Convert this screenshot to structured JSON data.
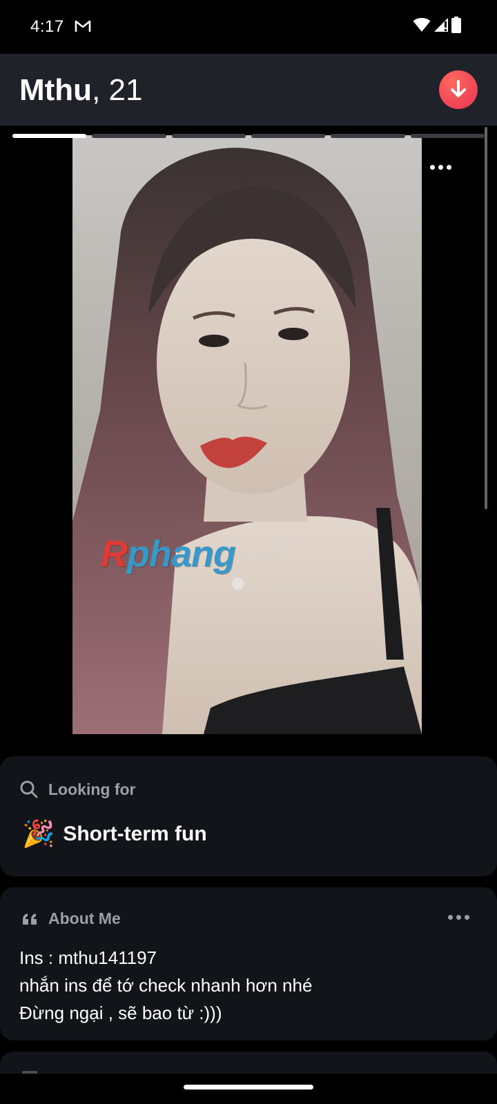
{
  "status_bar": {
    "time": "4:17",
    "icons": [
      "gmail-icon",
      "wifi-icon",
      "signal-icon",
      "battery-icon"
    ]
  },
  "header": {
    "name": "Mthu",
    "separator": ",",
    "age": "21",
    "action_icon": "arrow-down-icon",
    "action_color": "#ef4258"
  },
  "photo": {
    "photo_count": 6,
    "current_photo": 1,
    "watermark": {
      "first_letter": "R",
      "rest": "phang"
    },
    "more_icon": "ellipsis-icon",
    "description_icon": "profile-photo"
  },
  "looking_for": {
    "icon": "search-icon",
    "label": "Looking for",
    "emoji": "🎉",
    "value": "Short-term fun"
  },
  "about_me": {
    "icon": "quote-icon",
    "label": "About Me",
    "lines": [
      "Ins : mthu141197",
      "nhắn ins để tớ check nhanh hơn nhé",
      "Đừng ngại , sẽ bao từ :)))"
    ]
  },
  "colors": {
    "background": "#000000",
    "header_bg": "#1f2228",
    "card_bg": "#111418",
    "muted_text": "#9aa0a8",
    "accent": "#ef4258"
  }
}
